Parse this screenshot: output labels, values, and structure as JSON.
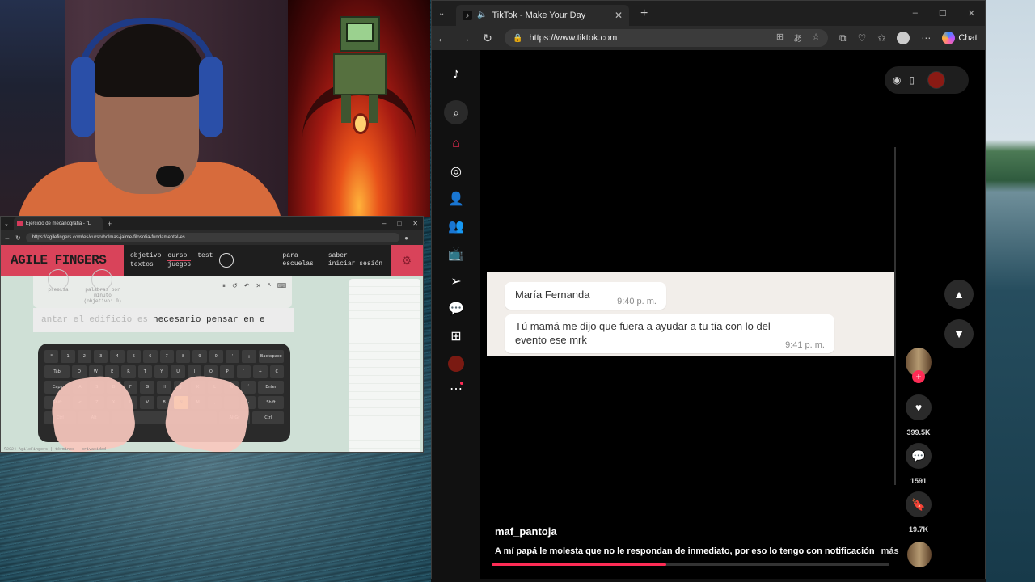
{
  "agile_fingers_window": {
    "tab_title": "Ejercicio de mecanografía - \"L",
    "url": "https://agilefingers.com/es/curso/bolmas-jaime-filosofia-fundamental-es",
    "logo": "AGILE FINGERS",
    "menu": [
      "objetivo",
      "curso",
      "test",
      "textos",
      "juegos"
    ],
    "menu_right": [
      "para",
      "saber",
      "escuelas",
      "iniciar sesión"
    ],
    "stats": [
      "precisa",
      "palabras por minuto (objetivo: 0)"
    ],
    "typed_text": "antar el edificio es",
    "remaining_text": "necesario pensar en e",
    "footer": "©2024 AgileFingers | términos | privacidad",
    "keyboard_rows": [
      [
        "º",
        "1",
        "2",
        "3",
        "4",
        "5",
        "6",
        "7",
        "8",
        "9",
        "0",
        "'",
        "¡",
        "Backspace"
      ],
      [
        "Tab",
        "Q",
        "W",
        "E",
        "R",
        "T",
        "Y",
        "U",
        "I",
        "O",
        "P",
        "`",
        "+",
        "Ç"
      ],
      [
        "Caps",
        "A",
        "S",
        "D",
        "F",
        "G",
        "H",
        "J",
        "K",
        "L",
        "Ñ",
        "´",
        "Enter"
      ],
      [
        "Shift",
        "<",
        "Z",
        "X",
        "C",
        "V",
        "B",
        "N",
        "M",
        ",",
        ".",
        "-",
        "Shift"
      ],
      [
        "Ctrl",
        "Alt",
        "",
        "AltGr",
        "Ctrl"
      ]
    ],
    "highlight_key": "N"
  },
  "edge_window": {
    "tab_title": "TikTok - Make Your Day",
    "url": "https://www.tiktok.com",
    "copilot_label": "Chat"
  },
  "tiktok": {
    "chat": {
      "sender": "María Fernanda",
      "time1": "9:40 p. m.",
      "message": "Tú mamá me dijo que fuera a ayudar a tu tía con lo del evento ese mrk",
      "time2": "9:41 p. m."
    },
    "likes": "399.5K",
    "comments": "1591",
    "saves": "19.7K",
    "username": "maf_pantoja",
    "caption": "A mí papá le molesta que no le respondan de inmediato, por eso lo tengo con notificación",
    "more": "más",
    "progress": 0.44
  },
  "colors": {
    "tiktok_red": "#fe2c55",
    "agile_pink": "#d9435a"
  }
}
